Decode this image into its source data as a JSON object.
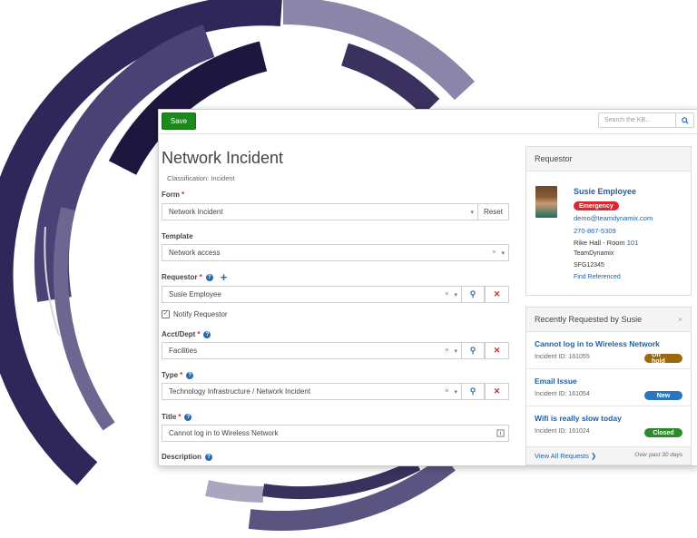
{
  "colors": {
    "save": "#1a8b1a",
    "link": "#1f5fa8",
    "emergency": "#d9282f",
    "on_hold": "#9b6a0f",
    "new": "#2a77bd",
    "closed": "#2b8a2b",
    "deco_dark": "#2c2456",
    "deco_mid": "#6e6a93"
  },
  "toolbar": {
    "save_label": "Save",
    "kb_search_placeholder": "Search the KB...",
    "kb_search_icon": "search-icon"
  },
  "form": {
    "title": "Network Incident",
    "classification": "Classification: Incident",
    "form_label": "Form",
    "form_value": "Network Incident",
    "reset_label": "Reset",
    "template_label": "Template",
    "template_value": "Network access",
    "requestor_label": "Requestor",
    "requestor_value": "Susie Employee",
    "notify_label": "Notify Requestor",
    "notify_checked": true,
    "acct_label": "Acct/Dept",
    "acct_value": "Facilities",
    "type_label": "Type",
    "type_value": "Technology Infrastructure / Network Incident",
    "title_label": "Title",
    "title_value": "Cannot log in to Wireless Network",
    "description_label": "Description",
    "required_mark": "*",
    "help_glyph": "?",
    "add_glyph": "+",
    "clear_glyph": "×",
    "caret_glyph": "▾",
    "search_glyph": "⚲",
    "remove_glyph": "✕"
  },
  "requestor_panel": {
    "heading": "Requestor",
    "name": "Susie Employee",
    "priority_badge": "Emergency",
    "email": "demo@teamdynamix.com",
    "phone": "270-867-5309",
    "location_prefix": "Rike Hall - Room ",
    "room": "101",
    "org": "TeamDynamix",
    "id": "SFG12345",
    "find_referenced": "Find Referenced"
  },
  "recent_panel": {
    "heading": "Recently Requested by Susie",
    "close_glyph": "×",
    "items": [
      {
        "title": "Cannot log in to Wireless Network",
        "id": "Incident ID: 161055",
        "status": "On hold"
      },
      {
        "title": "Email Issue",
        "id": "Incident ID: 161054",
        "status": "New"
      },
      {
        "title": "Wifi is really slow today",
        "id": "Incident ID: 161024",
        "status": "Closed"
      }
    ],
    "view_all": "View All Requests ❯",
    "past_days": "Over past 30 days"
  }
}
